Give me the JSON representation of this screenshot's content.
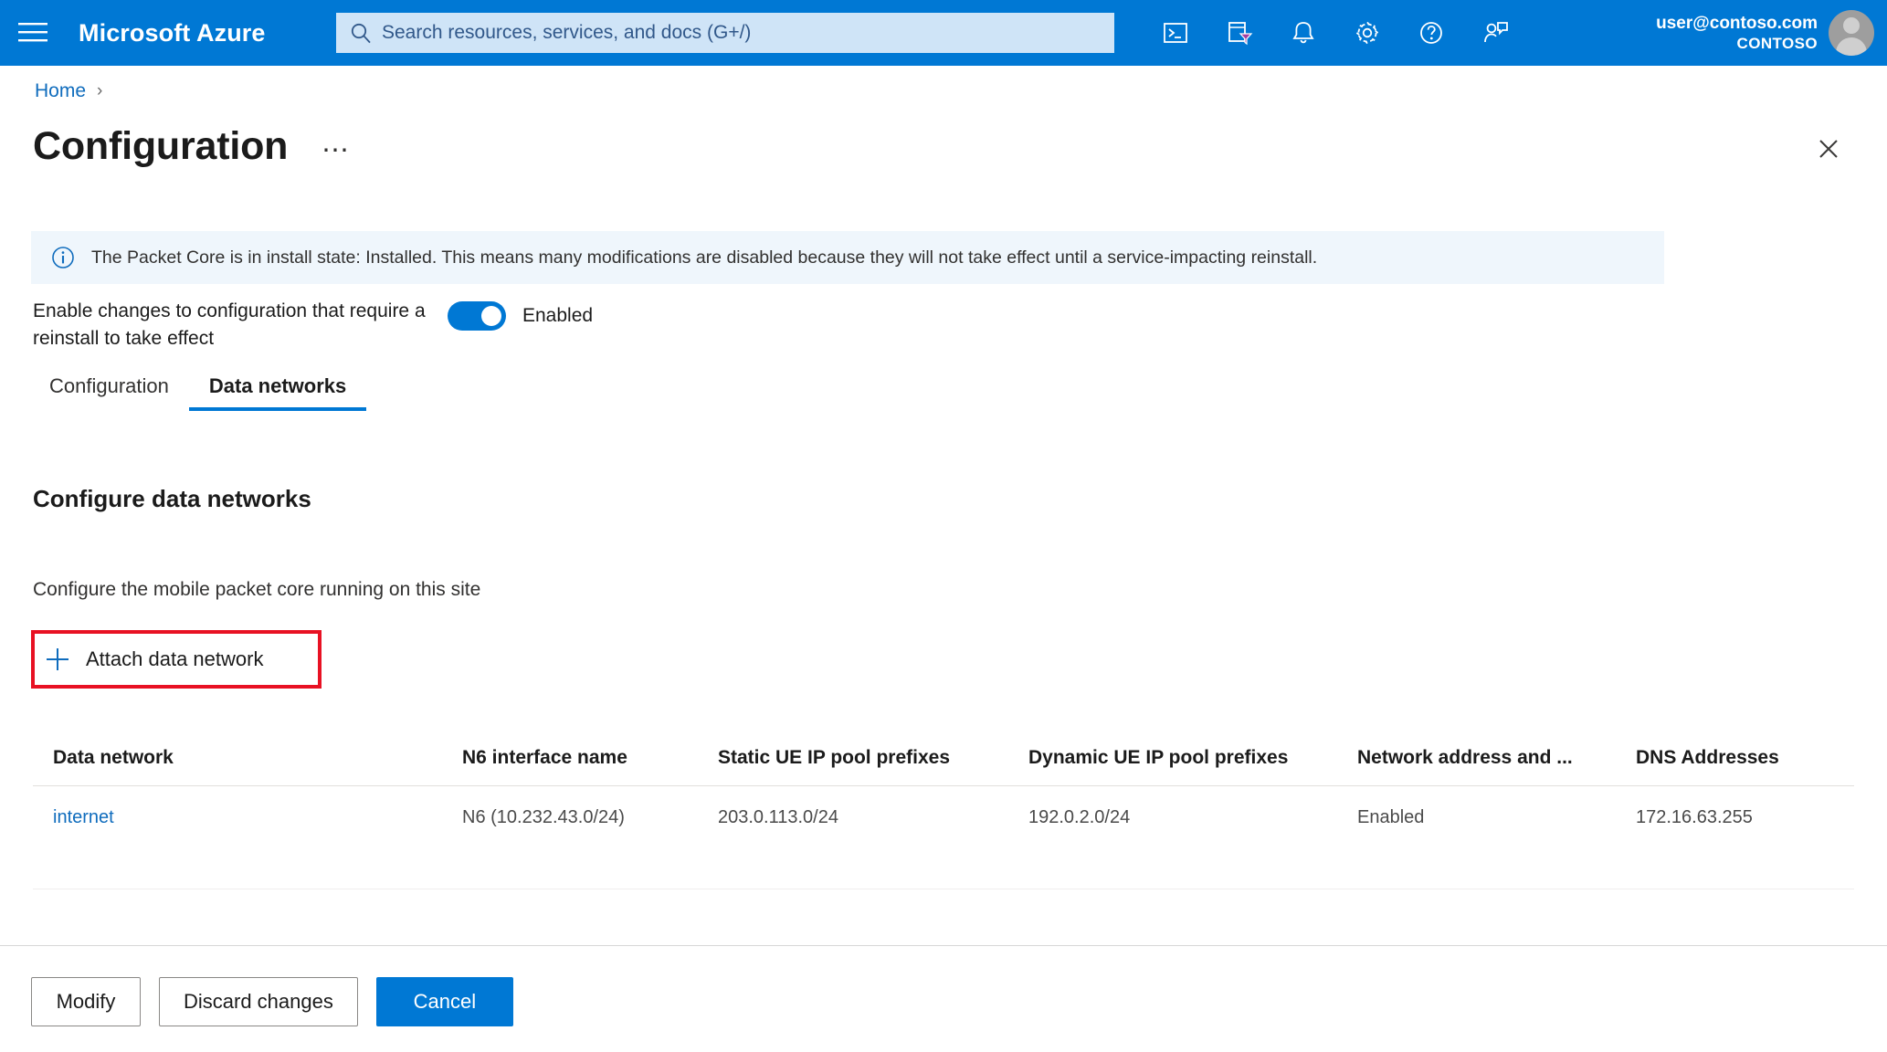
{
  "topbar": {
    "menu_icon": "hamburger-icon",
    "brand": "Microsoft Azure",
    "search": {
      "placeholder": "Search resources, services, and docs (G+/)",
      "value": "",
      "icon": "search-icon"
    },
    "icons": [
      {
        "name": "cloud-shell-icon",
        "label": "Cloud Shell"
      },
      {
        "name": "directories-subscriptions-icon",
        "label": "Directories + subscriptions"
      },
      {
        "name": "notifications-bell-icon",
        "label": "Notifications"
      },
      {
        "name": "settings-gear-icon",
        "label": "Settings"
      },
      {
        "name": "help-question-icon",
        "label": "Help"
      },
      {
        "name": "feedback-icon",
        "label": "Feedback"
      }
    ],
    "account": {
      "email": "user@contoso.com",
      "org": "CONTOSO",
      "avatar": "user-avatar"
    },
    "background_color": "#0078d4"
  },
  "breadcrumb": {
    "items": [
      "Home"
    ],
    "separator": "›"
  },
  "page": {
    "title": "Configuration",
    "more_label": "⋯",
    "close_label": "✕"
  },
  "banner": {
    "icon": "info-circle-icon",
    "text": "The Packet Core is in install state: Installed. This means many modifications are disabled because they will not take effect until a service-impacting reinstall.",
    "background_color": "#eff6fc"
  },
  "reinstall_toggle": {
    "label": "Enable changes to configuration that require a reinstall to take effect",
    "state_text": "Enabled",
    "checked": true,
    "accent_color": "#0078d4"
  },
  "tabs": [
    {
      "label": "Configuration",
      "active": false
    },
    {
      "label": "Data networks",
      "active": true
    }
  ],
  "section": {
    "heading": "Configure data networks",
    "description": "Configure the mobile packet core running on this site"
  },
  "attach_button": {
    "icon": "plus-icon",
    "label": "Attach data network",
    "highlight_color": "#e81123",
    "highlighted": true
  },
  "table": {
    "columns": [
      "Data network",
      "N6 interface name",
      "Static UE IP pool prefixes",
      "Dynamic UE IP pool prefixes",
      "Network address and ...",
      "DNS Addresses"
    ],
    "rows": [
      {
        "data_network": "internet",
        "n6_interface_name": "N6 (10.232.43.0/24)",
        "static_ue_ip_pool_prefixes": "203.0.113.0/24",
        "dynamic_ue_ip_pool_prefixes": "192.0.2.0/24",
        "network_address_and_port_translation": "Enabled",
        "dns_addresses": "172.16.63.255"
      }
    ]
  },
  "footer": {
    "modify_label": "Modify",
    "discard_label": "Discard changes",
    "cancel_label": "Cancel"
  }
}
